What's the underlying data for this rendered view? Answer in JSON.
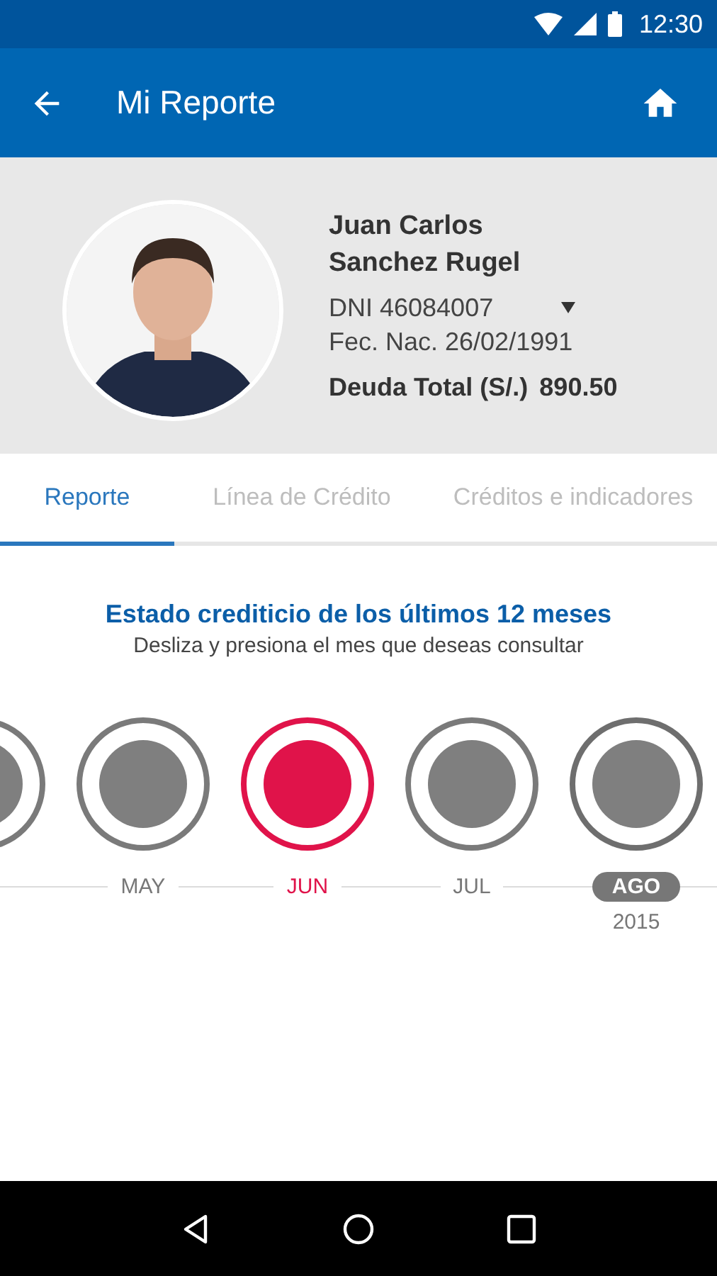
{
  "status_bar": {
    "time": "12:30"
  },
  "app_bar": {
    "title": "Mi Reporte"
  },
  "profile": {
    "name_line_1": "Juan Carlos",
    "name_line_2": "Sanchez Rugel",
    "dni": "DNI 46084007",
    "birth_date": "Fec. Nac. 26/02/1991",
    "debt_label": "Deuda Total (S/.)",
    "debt_value": "890.50"
  },
  "tabs": [
    {
      "label": "Reporte",
      "selected": true
    },
    {
      "label": "Línea de Crédito",
      "selected": false
    },
    {
      "label": "Créditos e indicadores",
      "selected": false
    }
  ],
  "report": {
    "heading": "Estado crediticio de los últimos 12 meses",
    "hint": "Desliza y presiona el mes que deseas consultar"
  },
  "months": [
    {
      "selected": false,
      "current": false
    },
    {
      "label": "MAY",
      "selected": false,
      "current": false
    },
    {
      "label": "JUN",
      "selected": true,
      "current": false
    },
    {
      "label": "JUL",
      "selected": false,
      "current": false
    },
    {
      "label": "AGO",
      "selected": false,
      "current": true,
      "year": "2015"
    }
  ]
}
